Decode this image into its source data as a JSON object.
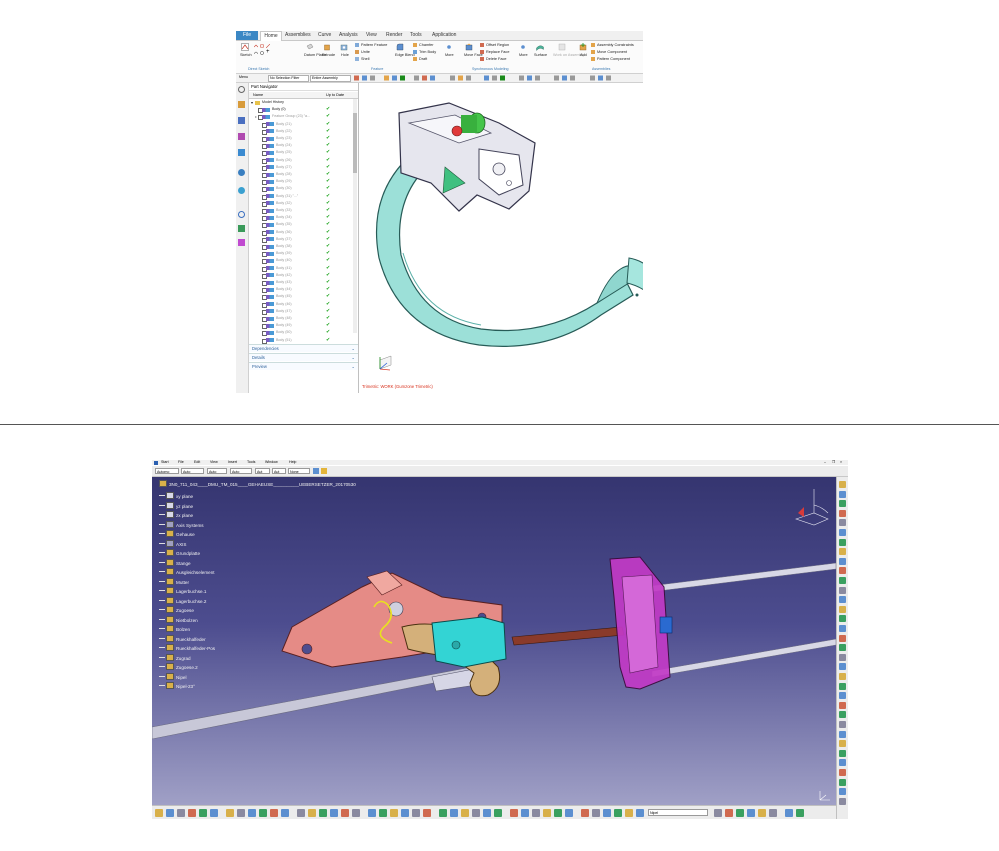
{
  "nx": {
    "tabs": {
      "file": "File",
      "home": "Home",
      "assemblies": "Assemblies",
      "curve": "Curve",
      "analysis": "Analysis",
      "view": "View",
      "render": "Render",
      "tools": "Tools",
      "application": "Application"
    },
    "ribbon": {
      "sketch": "Sketch",
      "direct_sketch": "Direct Sketch",
      "datum_plane": "Datum Plane",
      "extrude": "Extrude",
      "hole": "Hole",
      "pattern_feature": "Pattern Feature",
      "unite": "Unite",
      "shell": "Shell",
      "edge_blend": "Edge Blend",
      "chamfer": "Chamfer",
      "trim_body": "Trim Body",
      "draft": "Draft",
      "more": "More",
      "feature": "Feature",
      "move_face": "Move Face",
      "offset_region": "Offset Region",
      "replace_face": "Replace Face",
      "delete_face": "Delete Face",
      "synchronous_modeling": "Synchronous Modeling",
      "surface": "Surface",
      "work_on_assembly": "Work on Assembly",
      "add": "Add",
      "assembly_constraints": "Assembly Constraints",
      "move_component": "Move Component",
      "pattern_component": "Pattern Component",
      "assemblies_group": "Assemblies"
    },
    "cmdbar": {
      "menu": "Menu",
      "filter": "No Selection Filter",
      "scope": "Entire Assembly"
    },
    "navigator": {
      "title": "Part Navigator",
      "col_name": "Name",
      "col_uptodate": "Up to Date",
      "model_history": "Model History",
      "body_top": "Body (0)",
      "feature_group": "Feature Group (23) \"a...",
      "bodies": [
        "Body (21)",
        "Body (22)",
        "Body (23)",
        "Body (24)",
        "Body (25)",
        "Body (26)",
        "Body (27)",
        "Body (28)",
        "Body (29)",
        "Body (30)",
        "Body (31) \"...\"",
        "Body (32)",
        "Body (33)",
        "Body (34)",
        "Body (35)",
        "Body (36)",
        "Body (37)",
        "Body (38)",
        "Body (39)",
        "Body (40)",
        "Body (41)",
        "Body (42)",
        "Body (43)",
        "Body (44)",
        "Body (45)",
        "Body (46)",
        "Body (47)",
        "Body (48)",
        "Body (49)",
        "Body (50)",
        "Body (51)",
        "Body (52)"
      ],
      "sections": {
        "dependencies": "Dependencies",
        "details": "Details",
        "preview": "Preview"
      }
    },
    "status": "Trimetric: WORK (Gumzone Trimetric)"
  },
  "catia": {
    "menu": {
      "start": "Start",
      "file": "File",
      "edit": "Edit",
      "view": "View",
      "insert": "Insert",
      "tools": "Tools",
      "window": "Window",
      "help": "Help"
    },
    "toolbar": {
      "d1": "Automo",
      "d2": "Auto",
      "d3": "Auto",
      "d4": "Auto",
      "d5": "Aut",
      "d6": "Aut",
      "d7": "None"
    },
    "tree": {
      "root": "3N0_711_043____DMU_TM_015____GEHAEUSE__________UEBERSETZER_20170530",
      "items": [
        "xy plane",
        "yz plane",
        "zx plane",
        "Axis Systems",
        "Gehause",
        "AXIS",
        "Grundplatte",
        "Stange",
        "Ausgleichselement",
        "Mutter",
        "Lagerbuchse.1",
        "Lagerbuchse.2",
        "Zugoese",
        "Nietbolzen",
        "Bolzen",
        "Rueckhalfeder",
        "Rueckhalfeder-Pos",
        "Zugrad",
        "Zugoese.2",
        "Nipel",
        "Nipel-23°"
      ]
    },
    "bottom_combo": "Nipel"
  }
}
